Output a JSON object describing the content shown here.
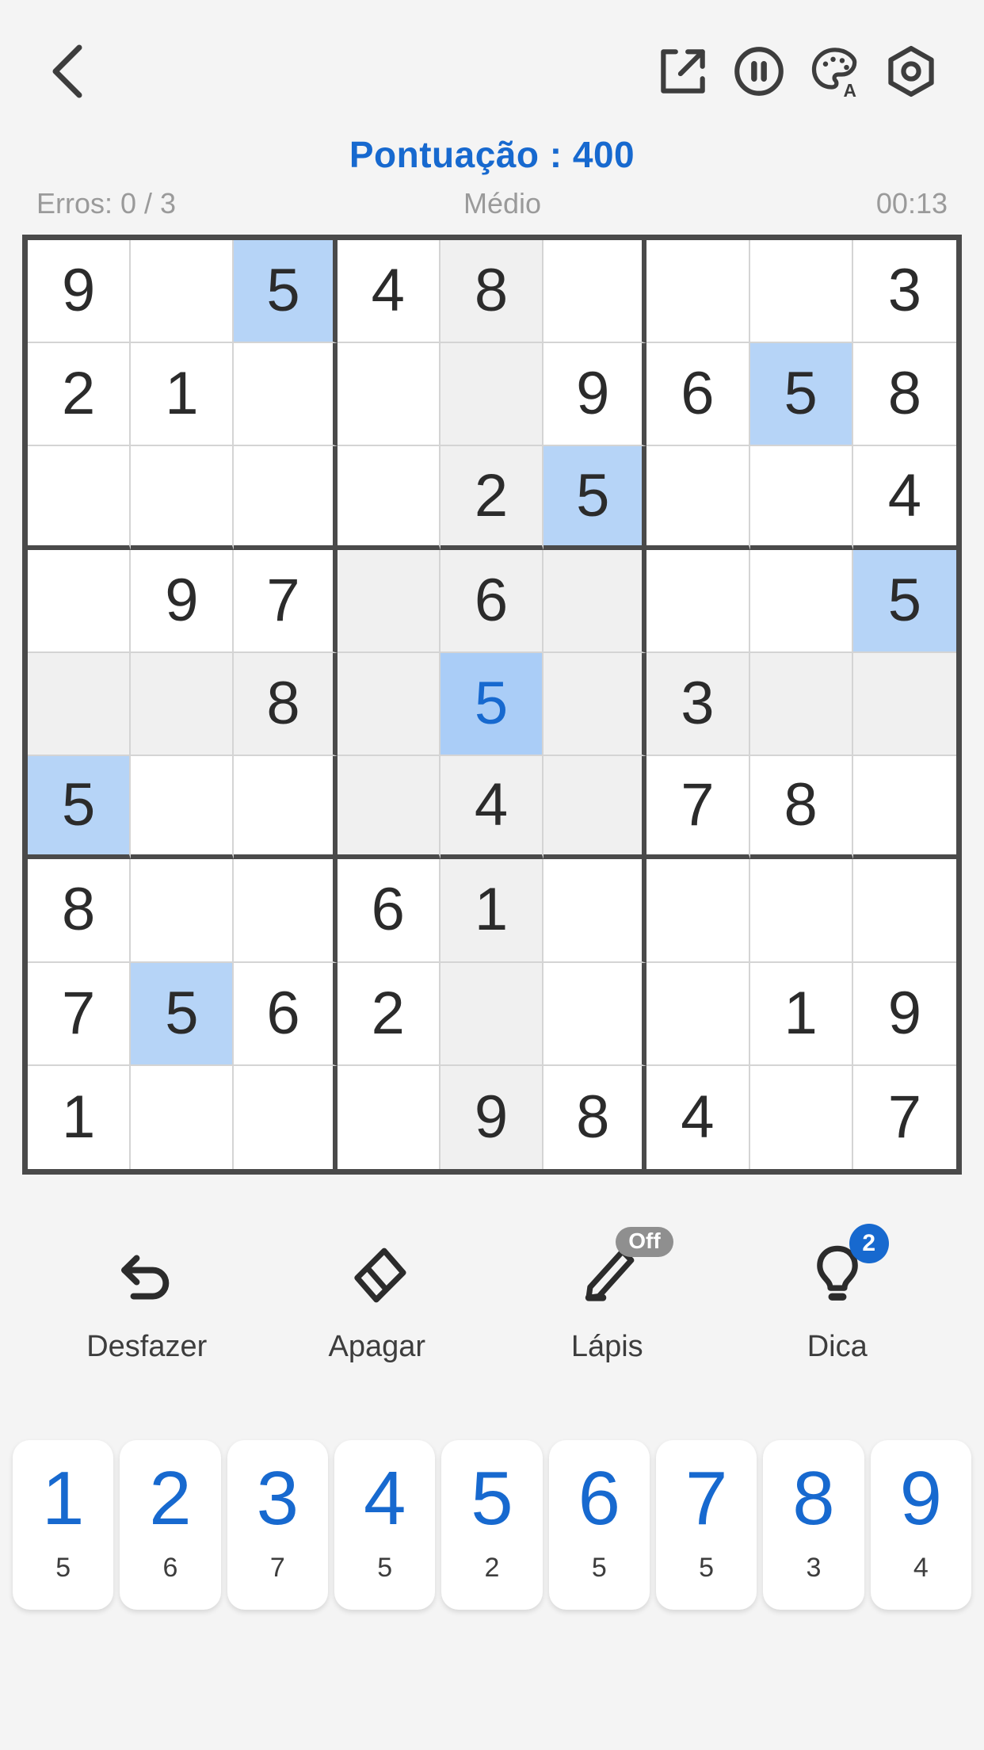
{
  "header": {
    "back_icon": "chevron-left-icon",
    "actions": [
      {
        "name": "share-icon",
        "label": "Share"
      },
      {
        "name": "pause-icon",
        "label": "Pause"
      },
      {
        "name": "theme-palette-icon",
        "label": "Theme"
      },
      {
        "name": "settings-icon",
        "label": "Settings"
      }
    ]
  },
  "status": {
    "score": "Pontuação : 400",
    "errors": "Erros: 0 / 3",
    "difficulty": "Médio",
    "timer": "00:13"
  },
  "colors": {
    "accent": "#1769cf",
    "selected_cell_bg": "#aacdf7",
    "same_number_bg": "#b6d4f7",
    "peer_bg": "#f0f0f0",
    "grid_line": "#4a4a4a",
    "muted_text": "#9a9a9a"
  },
  "board": {
    "selected": {
      "row": 4,
      "col": 4
    },
    "selected_value": "5",
    "rows": [
      [
        {
          "v": "9",
          "s": "normal"
        },
        {
          "v": "",
          "s": "normal"
        },
        {
          "v": "5",
          "s": "same"
        },
        {
          "v": "4",
          "s": "normal"
        },
        {
          "v": "8",
          "s": "peer"
        },
        {
          "v": "",
          "s": "normal"
        },
        {
          "v": "",
          "s": "normal"
        },
        {
          "v": "",
          "s": "normal"
        },
        {
          "v": "3",
          "s": "normal"
        }
      ],
      [
        {
          "v": "2",
          "s": "normal"
        },
        {
          "v": "1",
          "s": "normal"
        },
        {
          "v": "",
          "s": "normal"
        },
        {
          "v": "",
          "s": "normal"
        },
        {
          "v": "",
          "s": "peer"
        },
        {
          "v": "9",
          "s": "normal"
        },
        {
          "v": "6",
          "s": "normal"
        },
        {
          "v": "5",
          "s": "same"
        },
        {
          "v": "8",
          "s": "normal"
        }
      ],
      [
        {
          "v": "",
          "s": "normal"
        },
        {
          "v": "",
          "s": "normal"
        },
        {
          "v": "",
          "s": "normal"
        },
        {
          "v": "",
          "s": "normal"
        },
        {
          "v": "2",
          "s": "peer"
        },
        {
          "v": "5",
          "s": "same"
        },
        {
          "v": "",
          "s": "normal"
        },
        {
          "v": "",
          "s": "normal"
        },
        {
          "v": "4",
          "s": "normal"
        }
      ],
      [
        {
          "v": "",
          "s": "normal"
        },
        {
          "v": "9",
          "s": "normal"
        },
        {
          "v": "7",
          "s": "normal"
        },
        {
          "v": "",
          "s": "peer"
        },
        {
          "v": "6",
          "s": "peer"
        },
        {
          "v": "",
          "s": "peer"
        },
        {
          "v": "",
          "s": "normal"
        },
        {
          "v": "",
          "s": "normal"
        },
        {
          "v": "5",
          "s": "same"
        }
      ],
      [
        {
          "v": "",
          "s": "peer"
        },
        {
          "v": "",
          "s": "peer"
        },
        {
          "v": "8",
          "s": "peer"
        },
        {
          "v": "",
          "s": "peer"
        },
        {
          "v": "5",
          "s": "selected"
        },
        {
          "v": "",
          "s": "peer"
        },
        {
          "v": "3",
          "s": "peer"
        },
        {
          "v": "",
          "s": "peer"
        },
        {
          "v": "",
          "s": "peer"
        }
      ],
      [
        {
          "v": "5",
          "s": "same"
        },
        {
          "v": "",
          "s": "normal"
        },
        {
          "v": "",
          "s": "normal"
        },
        {
          "v": "",
          "s": "peer"
        },
        {
          "v": "4",
          "s": "peer"
        },
        {
          "v": "",
          "s": "peer"
        },
        {
          "v": "7",
          "s": "normal"
        },
        {
          "v": "8",
          "s": "normal"
        },
        {
          "v": "",
          "s": "normal"
        }
      ],
      [
        {
          "v": "8",
          "s": "normal"
        },
        {
          "v": "",
          "s": "normal"
        },
        {
          "v": "",
          "s": "normal"
        },
        {
          "v": "6",
          "s": "normal"
        },
        {
          "v": "1",
          "s": "peer"
        },
        {
          "v": "",
          "s": "normal"
        },
        {
          "v": "",
          "s": "normal"
        },
        {
          "v": "",
          "s": "normal"
        },
        {
          "v": "",
          "s": "normal"
        }
      ],
      [
        {
          "v": "7",
          "s": "normal"
        },
        {
          "v": "5",
          "s": "same"
        },
        {
          "v": "6",
          "s": "normal"
        },
        {
          "v": "2",
          "s": "normal"
        },
        {
          "v": "",
          "s": "peer"
        },
        {
          "v": "",
          "s": "normal"
        },
        {
          "v": "",
          "s": "normal"
        },
        {
          "v": "1",
          "s": "normal"
        },
        {
          "v": "9",
          "s": "normal"
        }
      ],
      [
        {
          "v": "1",
          "s": "normal"
        },
        {
          "v": "",
          "s": "normal"
        },
        {
          "v": "",
          "s": "normal"
        },
        {
          "v": "",
          "s": "normal"
        },
        {
          "v": "9",
          "s": "peer"
        },
        {
          "v": "8",
          "s": "normal"
        },
        {
          "v": "4",
          "s": "normal"
        },
        {
          "v": "",
          "s": "normal"
        },
        {
          "v": "7",
          "s": "normal"
        }
      ]
    ]
  },
  "tools": [
    {
      "name": "undo",
      "icon": "undo-arrow-icon",
      "label": "Desfazer",
      "badge": null
    },
    {
      "name": "erase",
      "icon": "eraser-icon",
      "label": "Apagar",
      "badge": null
    },
    {
      "name": "pencil",
      "icon": "pencil-icon",
      "label": "Lápis",
      "badge": "Off",
      "badge_type": "off"
    },
    {
      "name": "hint",
      "icon": "lightbulb-icon",
      "label": "Dica",
      "badge": "2",
      "badge_type": "count"
    }
  ],
  "numpad": [
    {
      "digit": "1",
      "count": "5"
    },
    {
      "digit": "2",
      "count": "6"
    },
    {
      "digit": "3",
      "count": "7"
    },
    {
      "digit": "4",
      "count": "5"
    },
    {
      "digit": "5",
      "count": "2"
    },
    {
      "digit": "6",
      "count": "5"
    },
    {
      "digit": "7",
      "count": "5"
    },
    {
      "digit": "8",
      "count": "3"
    },
    {
      "digit": "9",
      "count": "4"
    }
  ]
}
